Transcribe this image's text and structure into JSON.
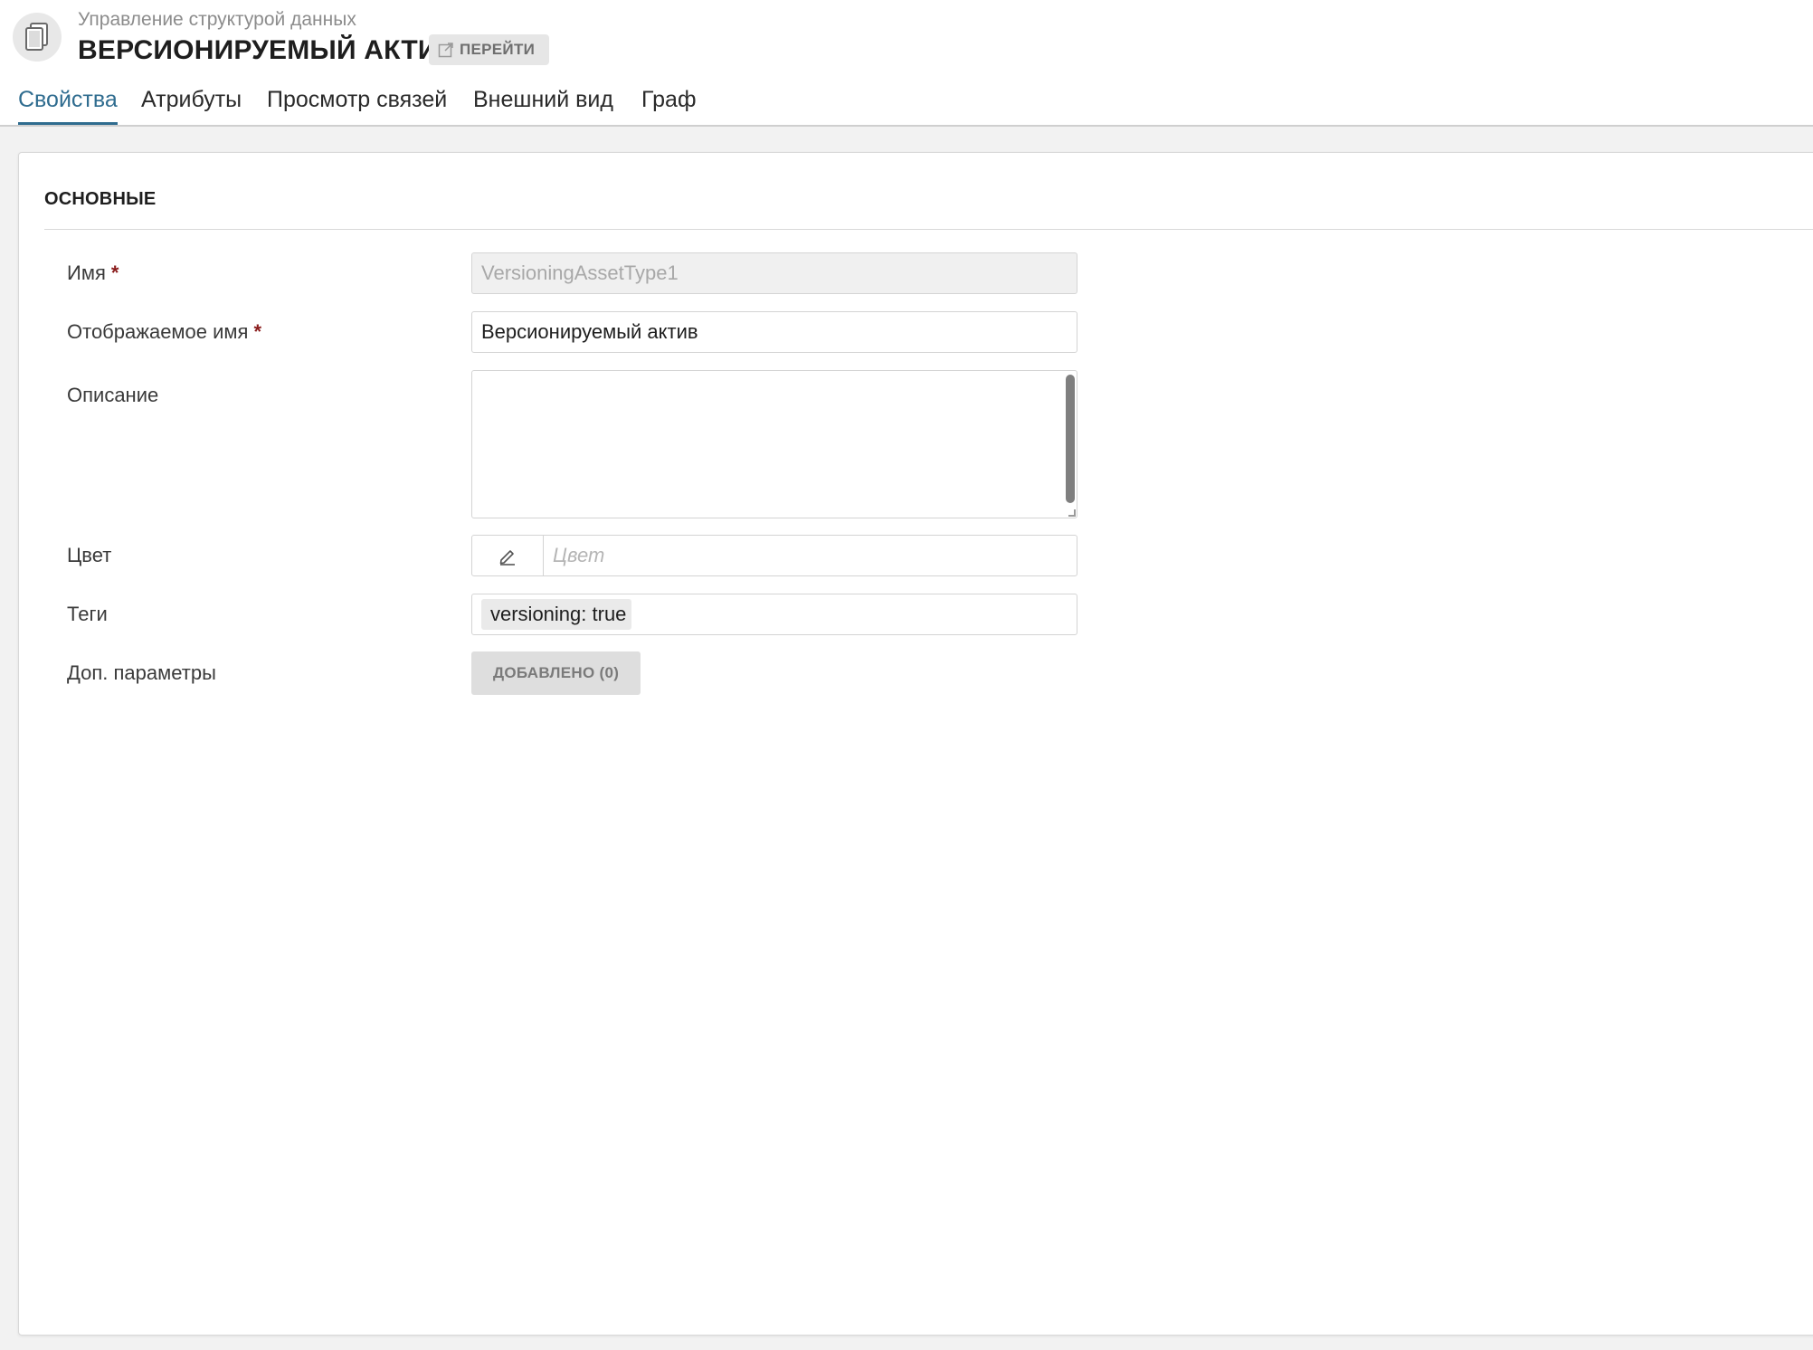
{
  "header": {
    "breadcrumb": "Управление структурой данных",
    "title": "ВЕРСИОНИРУЕМЫЙ АКТИВ",
    "goto_label": "ПЕРЕЙТИ",
    "app_icon": "documents-icon"
  },
  "tabs": [
    {
      "label": "Свойства",
      "active": true
    },
    {
      "label": "Атрибуты",
      "active": false
    },
    {
      "label": "Просмотр связей",
      "active": false
    },
    {
      "label": "Внешний вид",
      "active": false
    },
    {
      "label": "Граф",
      "active": false
    }
  ],
  "section": {
    "title": "ОСНОВНЫЕ"
  },
  "form": {
    "name": {
      "label": "Имя",
      "required_mark": "*",
      "value": "VersioningAssetType1",
      "disabled": true
    },
    "display_name": {
      "label": "Отображаемое имя",
      "required_mark": "*",
      "value": "Версионируемый актив"
    },
    "description": {
      "label": "Описание",
      "value": ""
    },
    "color": {
      "label": "Цвет",
      "placeholder": "Цвет",
      "icon": "pencil-icon"
    },
    "tags": {
      "label": "Теги",
      "items": [
        "versioning: true"
      ]
    },
    "extra_params": {
      "label": "Доп. параметры",
      "button_label": "ДОБАВЛЕНО (0)"
    }
  },
  "colors": {
    "accent": "#2f6c8f",
    "required": "#8a1c1c"
  }
}
